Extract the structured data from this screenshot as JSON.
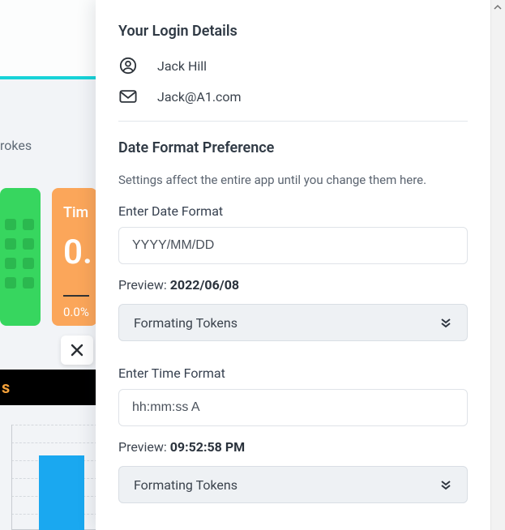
{
  "background": {
    "tab_partial": "rokes",
    "card_orange": {
      "title": "Tim",
      "big": "0.",
      "percent": "0.0%"
    },
    "black_bar_text": "s"
  },
  "panel": {
    "login_heading": "Your Login Details",
    "user_name": "Jack Hill",
    "user_email": "Jack@A1.com",
    "pref_heading": "Date Format Preference",
    "pref_sub": "Settings affect the entire app until you change them here.",
    "date": {
      "label": "Enter Date Format",
      "value": "YYYY/MM/DD",
      "preview_label": "Preview: ",
      "preview_value": "2022/06/08",
      "tokens_label": "Formating Tokens"
    },
    "time": {
      "label": "Enter Time Format",
      "value": "hh:mm:ss A",
      "preview_label": "Preview: ",
      "preview_value": "09:52:58 PM",
      "tokens_label": "Formating Tokens"
    }
  }
}
